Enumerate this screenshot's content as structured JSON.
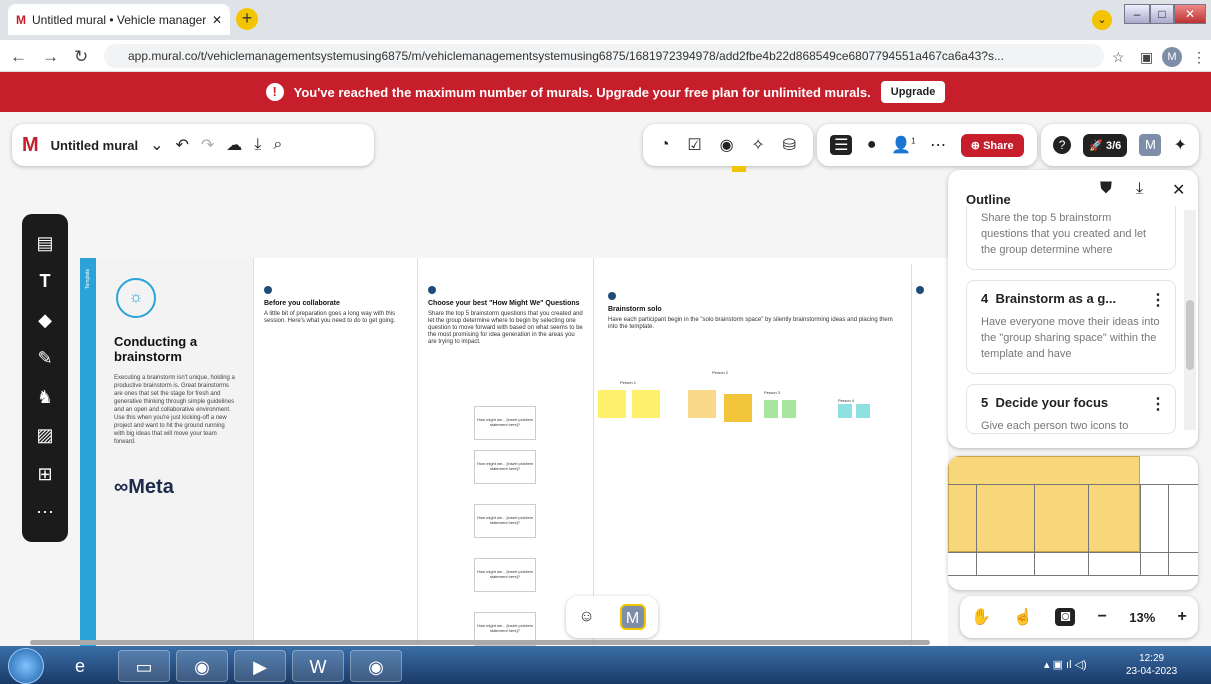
{
  "browser": {
    "tab_title": "Untitled mural • Vehicle manager",
    "url": "app.mural.co/t/vehiclemanagementsystemusing6875/m/vehiclemanagementsystemusing6875/1681972394978/add2fbe4b22d868549ce6807794551a467ca6a43?s...",
    "profile_initial": "M"
  },
  "banner": {
    "message": "You've reached the maximum number of murals. Upgrade your free plan for unlimited murals.",
    "button": "Upgrade"
  },
  "toolbar": {
    "mural_name": "Untitled mural",
    "share_label": "Share",
    "timer_label": "3/6",
    "avatar_initial": "M",
    "members_count": "1"
  },
  "board": {
    "side_tab": "Template",
    "title": "Conducting a brainstorm",
    "intro": "Executing a brainstorm isn't unique, holding a productive brainstorm is. Great brainstorms are ones that set the stage for fresh and generative thinking through simple guidelines and an open and collaborative environment. Use this when you're just kicking-off a new project and want to hit the ground running with big ideas that will move your team forward.",
    "meta_brand": "∞Meta",
    "sections": [
      {
        "title": "Before you collaborate",
        "body": "A little bit of preparation goes a long way with this session. Here's what you need to do to get going."
      },
      {
        "title": "Choose your best \"How Might We\" Questions",
        "body": "Share the top 5 brainstorm questions that you created and let the group determine where to begin by selecting one question to move forward with based on what seems to be the most promising for idea generation in the areas you are trying to impact."
      },
      {
        "title": "Brainstorm solo",
        "body": "Have each participant begin in the \"solo brainstorm space\" by silently brainstorming ideas and placing them into the template."
      }
    ],
    "card_label": "How might we... [insert problem statement here]?",
    "persons": [
      "Person 1",
      "Person 2",
      "Person 3",
      "Person 4"
    ]
  },
  "outline": {
    "title": "Outline",
    "items": [
      {
        "number": "",
        "title": "",
        "body": "Share the top 5 brainstorm questions that you created and let the group determine where"
      },
      {
        "number": "4",
        "title": "Brainstorm as a g...",
        "body": "Have everyone move their ideas into the \"group sharing space\" within the template and have"
      },
      {
        "number": "5",
        "title": "Decide your focus",
        "body": "Give each person two icons to"
      }
    ]
  },
  "zoom": {
    "level": "13%"
  },
  "taskbar": {
    "time": "12:29",
    "date": "23-04-2023"
  },
  "colors": {
    "brand_red": "#c61e2b",
    "accent_yellow": "#f3c400",
    "template_blue": "#2ba3d8"
  }
}
